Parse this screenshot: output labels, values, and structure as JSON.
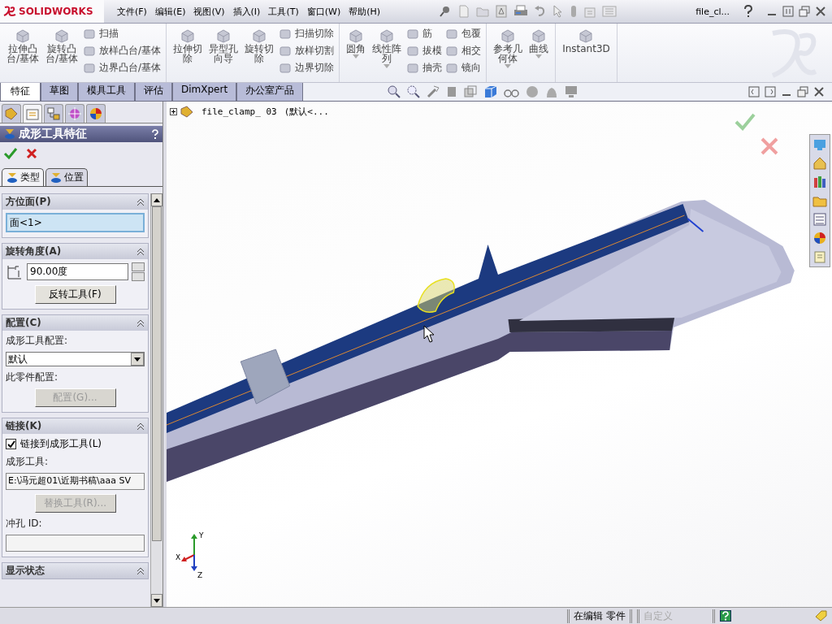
{
  "titlebar": {
    "logo": "SOLIDWORKS",
    "menu": [
      "文件(F)",
      "编辑(E)",
      "视图(V)",
      "插入(I)",
      "工具(T)",
      "窗口(W)",
      "帮助(H)"
    ],
    "document_title": "file_cl..."
  },
  "ribbon": [
    {
      "items": [
        {
          "kind": "large",
          "lines": [
            "拉伸凸",
            "台/基体"
          ],
          "dropdown": false
        },
        {
          "kind": "large",
          "lines": [
            "旋转凸",
            "台/基体"
          ],
          "dropdown": false
        },
        {
          "kind": "stack",
          "items": [
            "扫描",
            "放样凸台/基体",
            "边界凸台/基体"
          ]
        }
      ]
    },
    {
      "items": [
        {
          "kind": "large",
          "lines": [
            "拉伸切",
            "除"
          ],
          "dropdown": false
        },
        {
          "kind": "large",
          "lines": [
            "异型孔",
            "向导"
          ],
          "dropdown": false
        },
        {
          "kind": "large",
          "lines": [
            "旋转切",
            "除"
          ],
          "dropdown": false
        },
        {
          "kind": "stack",
          "items": [
            "扫描切除",
            "放样切割",
            "边界切除"
          ]
        }
      ]
    },
    {
      "items": [
        {
          "kind": "large",
          "lines": [
            "圆角"
          ],
          "dropdown": true
        },
        {
          "kind": "large",
          "lines": [
            "线性阵",
            "列"
          ],
          "dropdown": true
        },
        {
          "kind": "stack",
          "items": [
            "筋",
            "拔模",
            "抽壳"
          ]
        },
        {
          "kind": "stack",
          "items": [
            "包覆",
            "相交",
            "镜向"
          ]
        }
      ]
    },
    {
      "items": [
        {
          "kind": "large",
          "lines": [
            "参考几",
            "何体"
          ],
          "dropdown": true
        },
        {
          "kind": "large",
          "lines": [
            "曲线"
          ],
          "dropdown": true
        }
      ]
    },
    {
      "items": [
        {
          "kind": "large",
          "lines": [
            "Instant3D"
          ],
          "dropdown": false
        }
      ]
    }
  ],
  "command_tabs": [
    {
      "label": "特征",
      "selected": true
    },
    {
      "label": "草图",
      "selected": false
    },
    {
      "label": "模具工具",
      "selected": false
    },
    {
      "label": "评估",
      "selected": false
    },
    {
      "label": "DimXpert",
      "selected": false
    },
    {
      "label": "办公室产品",
      "selected": false
    }
  ],
  "manager_tabs": [
    {
      "kind": "feature",
      "selected": false
    },
    {
      "kind": "property",
      "selected": true
    },
    {
      "kind": "config",
      "selected": false
    },
    {
      "kind": "dimxpert",
      "selected": false
    },
    {
      "kind": "display",
      "selected": false
    }
  ],
  "property_manager": {
    "title": "成形工具特征",
    "tabs": [
      {
        "label": "类型",
        "selected": true
      },
      {
        "label": "位置",
        "selected": false
      }
    ],
    "sections": [
      {
        "title": "方位面(P)",
        "expanded": true,
        "controls": [
          {
            "kind": "selection",
            "value": "面<1>"
          }
        ]
      },
      {
        "title": "旋转角度(A)",
        "expanded": true,
        "controls": [
          {
            "kind": "spin",
            "value": "90.00度"
          },
          {
            "kind": "button",
            "label": "反转工具(F)",
            "disabled": false
          }
        ]
      },
      {
        "title": "配置(C)",
        "expanded": true,
        "controls": [
          {
            "kind": "label",
            "text": "成形工具配置:"
          },
          {
            "kind": "dropdown",
            "value": "默认"
          },
          {
            "kind": "label",
            "text": "此零件配置:"
          },
          {
            "kind": "button",
            "label": "配置(G)...",
            "disabled": true
          }
        ]
      },
      {
        "title": "链接(K)",
        "expanded": true,
        "controls": [
          {
            "kind": "checkbox",
            "label": "链接到成形工具(L)",
            "checked": true
          },
          {
            "kind": "label",
            "text": "成形工具:"
          },
          {
            "kind": "field",
            "value": "E:\\冯元超01\\近期书稿\\aaa SV"
          },
          {
            "kind": "button",
            "label": "替换工具(R)...",
            "disabled": true
          },
          {
            "kind": "label",
            "text": "冲孔 ID:"
          },
          {
            "kind": "field"
          }
        ]
      },
      {
        "title": "显示状态",
        "expanded": true
      }
    ]
  },
  "feature_tree": {
    "root": "file_clamp_ 03",
    "configuration": "(默认<...",
    "expanded": false
  },
  "triad": {
    "labels": [
      "Y",
      "X",
      "Z"
    ]
  },
  "status_bar": {
    "mode": "在编辑 零件",
    "custom": "自定义"
  }
}
